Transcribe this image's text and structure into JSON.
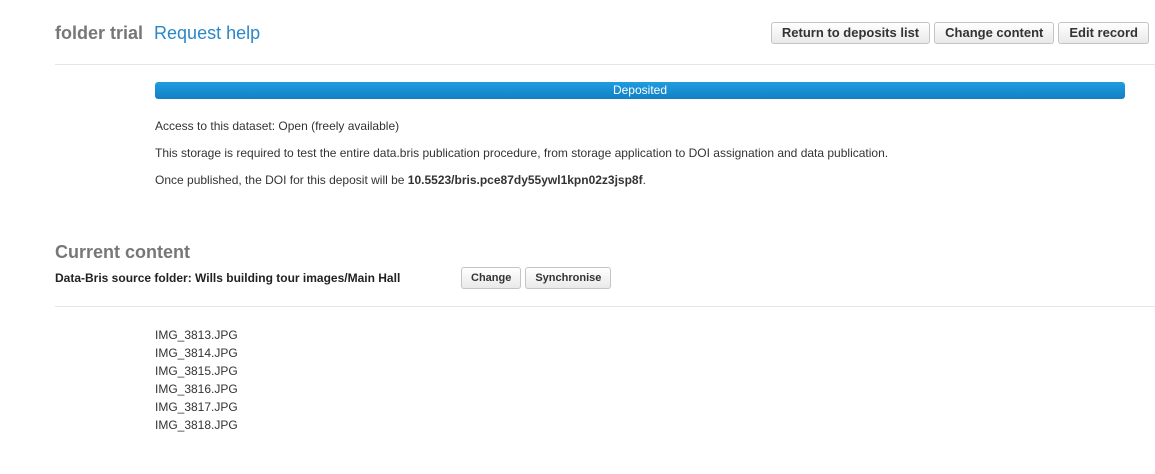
{
  "header": {
    "title": "folder trial",
    "help_link": "Request help",
    "buttons": {
      "return": "Return to deposits list",
      "change_content": "Change content",
      "edit_record": "Edit record"
    }
  },
  "status": {
    "label": "Deposited",
    "progress_percent": 100
  },
  "info": {
    "access": "Access to this dataset: Open (freely available)",
    "description": "This storage is required to test the entire data.bris publication procedure, from storage application to DOI assignation and data publication.",
    "doi_prefix": "Once published, the DOI for this deposit will be ",
    "doi": "10.5523/bris.pce87dy55ywl1kpn02z3jsp8f",
    "doi_suffix": "."
  },
  "content": {
    "title": "Current content",
    "source_label": "Data-Bris source folder: Wills building tour images/Main Hall",
    "buttons": {
      "change": "Change",
      "synchronise": "Synchronise"
    },
    "files": [
      "IMG_3813.JPG",
      "IMG_3814.JPG",
      "IMG_3815.JPG",
      "IMG_3816.JPG",
      "IMG_3817.JPG",
      "IMG_3818.JPG"
    ]
  }
}
